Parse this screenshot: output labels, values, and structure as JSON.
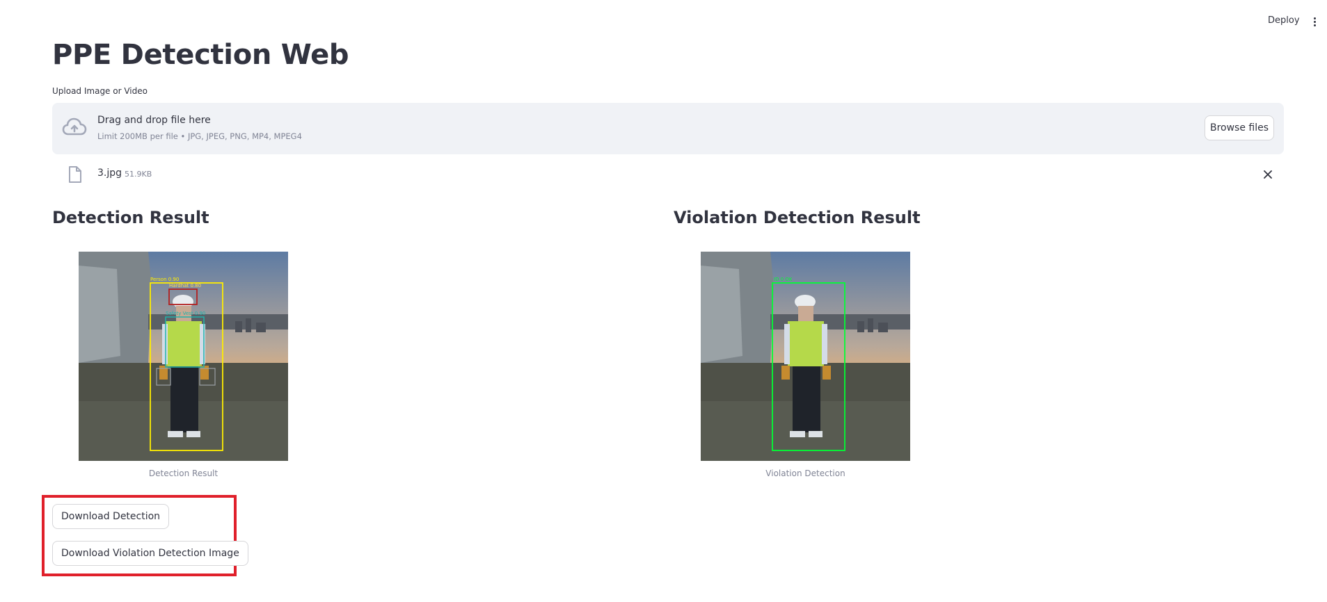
{
  "header": {
    "deploy_label": "Deploy"
  },
  "page": {
    "title": "PPE Detection Web"
  },
  "uploader": {
    "label": "Upload Image or Video",
    "drop_title": "Drag and drop file here",
    "limit_text": "Limit 200MB per file • JPG, JPEG, PNG, MP4, MPEG4",
    "browse_label": "Browse files",
    "file": {
      "name": "3.jpg",
      "size": "51.9KB"
    }
  },
  "results": {
    "left": {
      "heading": "Detection Result",
      "caption": "Detection Result",
      "labels": {
        "person": "Person 0.90",
        "hardhat": "Hardhat 0.80",
        "vest": "Safety Vest 0.90"
      }
    },
    "right": {
      "heading": "Violation Detection Result",
      "caption": "Violation Detection",
      "labels": {
        "person": "ID 0 OK"
      }
    }
  },
  "downloads": {
    "detection_label": "Download Detection",
    "violation_label": "Download Violation Detection Image"
  },
  "colors": {
    "accent_highlight": "#e0202b",
    "dropzone_bg": "#f0f2f6",
    "text": "#31333f",
    "muted": "#808495",
    "box_yellow": "#ffee00",
    "box_green": "#00ff33",
    "box_red": "#b32020",
    "box_teal": "#20b2aa"
  },
  "icons": {
    "upload": "cloud-upload-icon",
    "file": "file-icon",
    "close": "close-icon",
    "menu": "kebab-menu-icon"
  }
}
